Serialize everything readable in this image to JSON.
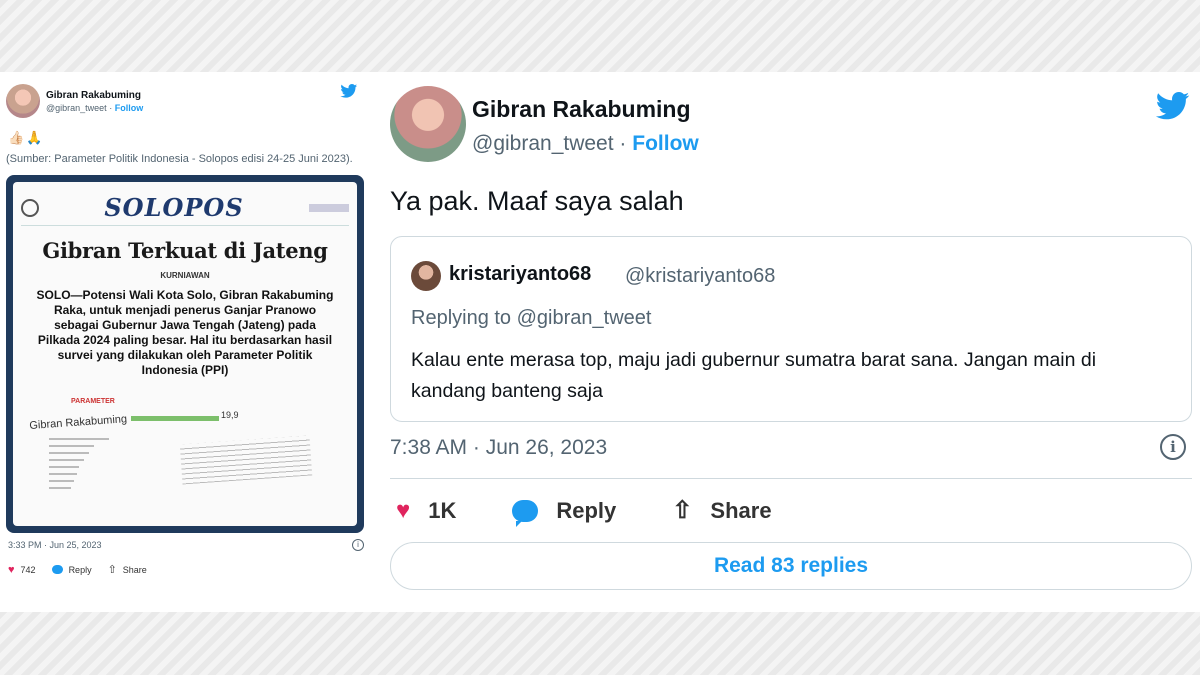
{
  "left_tweet": {
    "name": "Gibran Rakabuming",
    "handle": "@gibran_tweet",
    "separator": "·",
    "follow_label": "Follow",
    "emoji": "👍🏻🙏",
    "text": "(Sumber: Parameter Politik Indonesia - Solopos edisi 24-25 Juni 2023).",
    "newspaper": {
      "masthead": "SOLOPOS",
      "headline": "Gibran Terkuat di Jateng",
      "byline": "KURNIAWAN",
      "body": "SOLO—Potensi Wali Kota Solo, Gibran Rakabuming Raka, untuk menjadi penerus Ganjar Pranowo sebagai Gubernur Jawa Tengah (Jateng) pada Pilkada 2024 paling besar. Hal itu berdasarkan hasil survei yang dilakukan oleh Parameter Politik Indonesia (PPI)",
      "chart_label": "PARAMETER",
      "chart_name": "Gibran Rakabuming",
      "chart_value": "19,9"
    },
    "timestamp": "3:33 PM · Jun 25, 2023",
    "likes": "742",
    "reply_label": "Reply",
    "share_label": "Share"
  },
  "right_tweet": {
    "name": "Gibran Rakabuming",
    "handle": "@gibran_tweet",
    "separator": "·",
    "follow_label": "Follow",
    "text": "Ya pak. Maaf saya salah",
    "quoted": {
      "name": "kristariyanto68",
      "handle": "@kristariyanto68",
      "replying_to": "Replying to @gibran_tweet",
      "text": "Kalau ente merasa top, maju jadi gubernur sumatra barat sana. Jangan main di kandang banteng saja"
    },
    "timestamp": "7:38 AM · Jun 26, 2023",
    "likes": "1K",
    "reply_label": "Reply",
    "share_label": "Share",
    "read_replies": "Read 83 replies"
  },
  "colors": {
    "brand_blue": "#1d9bf0",
    "like_pink": "#e0245e",
    "text_dark": "#0f1419",
    "text_muted": "#536471"
  },
  "icons": [
    "twitter-bird-icon",
    "heart-icon",
    "reply-bubble-icon",
    "share-icon",
    "info-icon"
  ]
}
